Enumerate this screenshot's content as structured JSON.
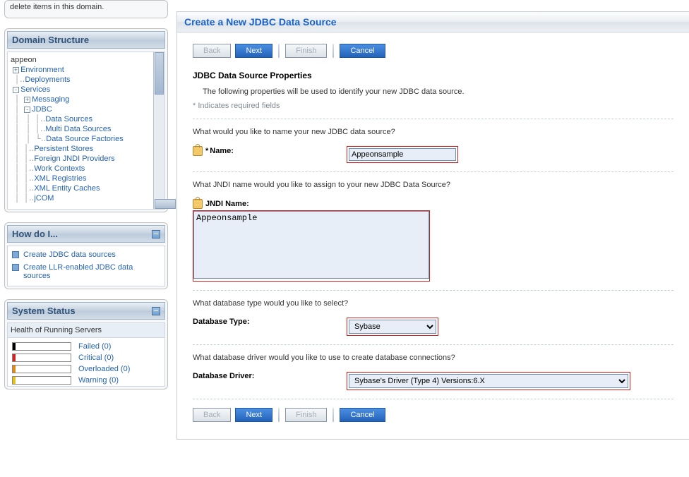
{
  "leftpanel_trunc": "delete items in this domain.",
  "domain_structure": {
    "title": "Domain Structure",
    "root": "appeon",
    "environment": "Environment",
    "deployments": "Deployments",
    "services": "Services",
    "messaging": "Messaging",
    "jdbc": "JDBC",
    "datasources": "Data Sources",
    "multi_ds": "Multi Data Sources",
    "ds_factories": "Data Source Factories",
    "persistent_stores": "Persistent Stores",
    "foreign_jndi": "Foreign JNDI Providers",
    "work_contexts": "Work Contexts",
    "xml_registries": "XML Registries",
    "xml_entity": "XML Entity Caches",
    "jcom": "jCOM"
  },
  "how_do_i": {
    "title": "How do I...",
    "items": [
      "Create JDBC data sources",
      "Create LLR-enabled JDBC data sources"
    ]
  },
  "system_status": {
    "title": "System Status",
    "sub": "Health of Running Servers",
    "rows": [
      {
        "label": "Failed (0)",
        "color": "#000000"
      },
      {
        "label": "Critical (0)",
        "color": "#d22323"
      },
      {
        "label": "Overloaded (0)",
        "color": "#e08a1a"
      },
      {
        "label": "Warning (0)",
        "color": "#e4c21b"
      }
    ]
  },
  "main": {
    "title": "Create a New JDBC Data Source",
    "buttons": {
      "back": "Back",
      "next": "Next",
      "finish": "Finish",
      "cancel": "Cancel"
    },
    "sect_title": "JDBC Data Source Properties",
    "sect_desc": "The following properties will be used to identify your new JDBC data source.",
    "req_note": "* Indicates required fields",
    "q_name": "What would you like to name your new JDBC data source?",
    "lbl_name": "Name:",
    "val_name": "Appeonsample",
    "q_jndi": "What JNDI name would you like to assign to your new JDBC Data Source?",
    "lbl_jndi": "JNDI Name:",
    "val_jndi": "Appeonsample",
    "q_dbtype": "What database type would you like to select?",
    "lbl_dbtype": "Database Type:",
    "val_dbtype": "Sybase",
    "q_driver": "What database driver would you like to use to create database connections?",
    "lbl_driver": "Database Driver:",
    "val_driver": "Sybase's Driver (Type 4) Versions:6.X"
  }
}
